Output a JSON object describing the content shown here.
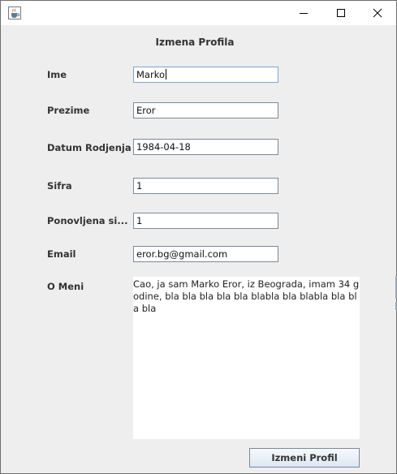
{
  "window": {
    "minimize_icon": "minimize-icon",
    "maximize_icon": "maximize-icon",
    "close_icon": "close-icon",
    "app_icon": "java-cup-icon"
  },
  "form": {
    "title": "Izmena Profila",
    "fields": [
      {
        "label": "Ime",
        "value": "Marko"
      },
      {
        "label": "Prezime",
        "value": "Eror"
      },
      {
        "label": "Datum Rodjenja",
        "value": "1984-04-18"
      },
      {
        "label": "Sifra",
        "value": "1"
      },
      {
        "label": "Ponovljena si...",
        "value": "1"
      },
      {
        "label": "Email",
        "value": "eror.bg@gmail.com"
      }
    ],
    "about": {
      "label": "O Meni",
      "value": "Cao, ja sam Marko Eror, iz Beograda, imam 34 godine, bla bla bla bla bla blabla bla blabla bla bla bla"
    },
    "submit_label": "Izmeni Profil"
  },
  "colors": {
    "background": "#eeeeee",
    "field_border": "#7a8a9a",
    "focus_border": "#7aa6d6"
  }
}
